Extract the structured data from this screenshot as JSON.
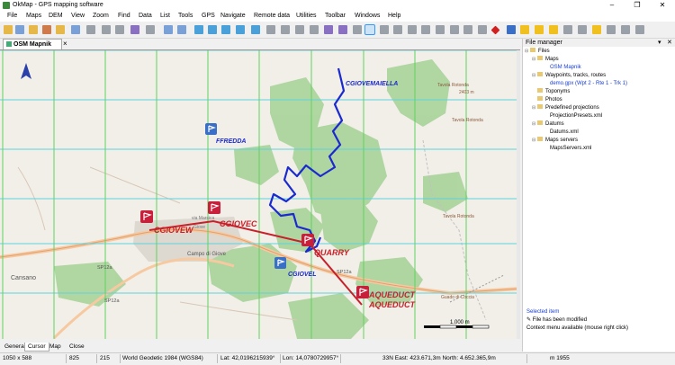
{
  "window": {
    "title": "OkMap - GPS mapping software",
    "controls": [
      "–",
      "❐",
      "✕"
    ]
  },
  "menu": [
    "File",
    "Maps",
    "DEM",
    "View",
    "Zoom",
    "Find",
    "Data",
    "List",
    "Tools",
    "GPS",
    "Navigate",
    "Remote data",
    "Utilities",
    "Toolbar",
    "Windows",
    "Help"
  ],
  "map_tab": {
    "label": "OSM Mapnik",
    "close": "×"
  },
  "map": {
    "waypoints": {
      "cgiovew": "CGIOVEW",
      "cgiovec": "CGIOVEC",
      "quarry": "QUARRY",
      "aqueduct": "AQUEDUCT",
      "ffredda": "FFREDDA",
      "cgiovel": "CGIOVEL",
      "cgiovemaiella": "CGIOVEMAIELLA"
    },
    "places": {
      "cansano": "Cansano",
      "campo_di_giove": "Campo di Giove",
      "sp12a_1": "SP12a",
      "sp12a_2": "SP12a",
      "sp12a_3": "SP12a",
      "tavola_rotonda_1": "Tavola Rotonda",
      "tavola_rotonda_2": "Tavola Rotonda",
      "tavola_elev": "2403 m",
      "tavola_rotonda_3": "Tavola Rotonda",
      "guado": "Guado di Coccia",
      "via_marsica": "via Marsica",
      "giove": "Giove"
    },
    "scale": "1.000 m"
  },
  "bottom_tabs": [
    "General",
    "Cursor",
    "Map",
    "Close"
  ],
  "status": {
    "size": "1050 x 588",
    "v1": "825",
    "v2": "215",
    "datum": "World Geodetic 1984 (WGS84)",
    "lat": "Lat: 42,0196215939°",
    "lon": "Lon: 14,0780729957°",
    "utm": "33N  East: 423.671,3m  North: 4.652.365,9m",
    "elev": "m 1955"
  },
  "file_manager": {
    "title": "File manager",
    "pin": "▾",
    "close": "✕",
    "tree": [
      {
        "label": "Files",
        "level": 0,
        "link": false
      },
      {
        "label": "Maps",
        "level": 1,
        "link": false
      },
      {
        "label": "OSM Mapnik",
        "level": 2,
        "link": true
      },
      {
        "label": "Waypoints, tracks, routes",
        "level": 1,
        "link": false
      },
      {
        "label": "demo.gpx (Wpt 2 - Rte 1 - Trk 1)",
        "level": 2,
        "link": true
      },
      {
        "label": "Toponyms",
        "level": 1,
        "link": false
      },
      {
        "label": "Photos",
        "level": 1,
        "link": false
      },
      {
        "label": "Predefined projections",
        "level": 1,
        "link": false
      },
      {
        "label": "ProjectionPresets.xml",
        "level": 2,
        "link": false
      },
      {
        "label": "Datums",
        "level": 1,
        "link": false
      },
      {
        "label": "Datums.xml",
        "level": 2,
        "link": false
      },
      {
        "label": "Maps servers",
        "level": 1,
        "link": false
      },
      {
        "label": "MapsServers.xml",
        "level": 2,
        "link": false
      }
    ],
    "info": {
      "selected_title": "Selected item",
      "modified": "File has been modified",
      "context": "Context menu available (mouse right click)"
    }
  },
  "colors": {
    "route": "#c8202a",
    "track": "#1a2ad0",
    "grid_green": "#5fd35f",
    "grid_cyan": "#5ed3e0",
    "forest": "#a8d39a",
    "waypoint_flag": "#c8203a",
    "waypoint_blue": "#3a6fc8"
  }
}
